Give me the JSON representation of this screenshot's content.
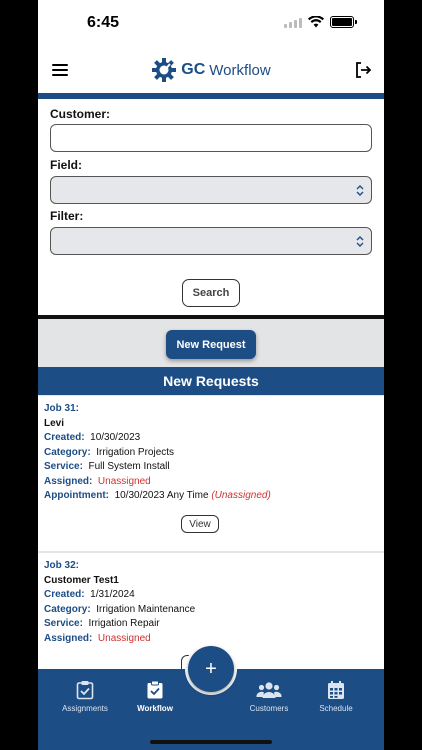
{
  "status_bar": {
    "time": "6:45"
  },
  "header": {
    "logo_primary": "GC",
    "logo_secondary": "Workflow",
    "menu_icon": "hamburger-icon",
    "logout_icon": "logout-icon"
  },
  "search_form": {
    "customer_label": "Customer:",
    "customer_value": "",
    "field_label": "Field:",
    "field_value": "",
    "filter_label": "Filter:",
    "filter_value": "",
    "search_button": "Search"
  },
  "new_request_button": "New Request",
  "section_title": "New Requests",
  "labels": {
    "created": "Created:",
    "category": "Category:",
    "service": "Service:",
    "assigned": "Assigned:",
    "appointment": "Appointment:"
  },
  "requests": [
    {
      "job": "Job 31:",
      "customer": "Levi",
      "created": "10/30/2023",
      "category": "Irrigation Projects",
      "service": "Full System Install",
      "assigned": "Unassigned",
      "appointment": "10/30/2023 Any Time",
      "appointment_status": "(Unassigned)",
      "view_button": "View"
    },
    {
      "job": "Job 32:",
      "customer": "Customer Test1",
      "created": "1/31/2024",
      "category": "Irrigation Maintenance",
      "service": "Irrigation Repair",
      "assigned": "Unassigned"
    }
  ],
  "bottom_nav": {
    "items": [
      {
        "label": "Assignments",
        "icon": "clipboard-check-icon"
      },
      {
        "label": "Workflow",
        "icon": "clipboard-list-icon",
        "active": true
      },
      {
        "label": "Customers",
        "icon": "users-icon"
      },
      {
        "label": "Schedule",
        "icon": "calendar-icon"
      }
    ],
    "fab_label": "+"
  },
  "colors": {
    "brand": "#1d4d85",
    "danger": "#d0312d"
  }
}
